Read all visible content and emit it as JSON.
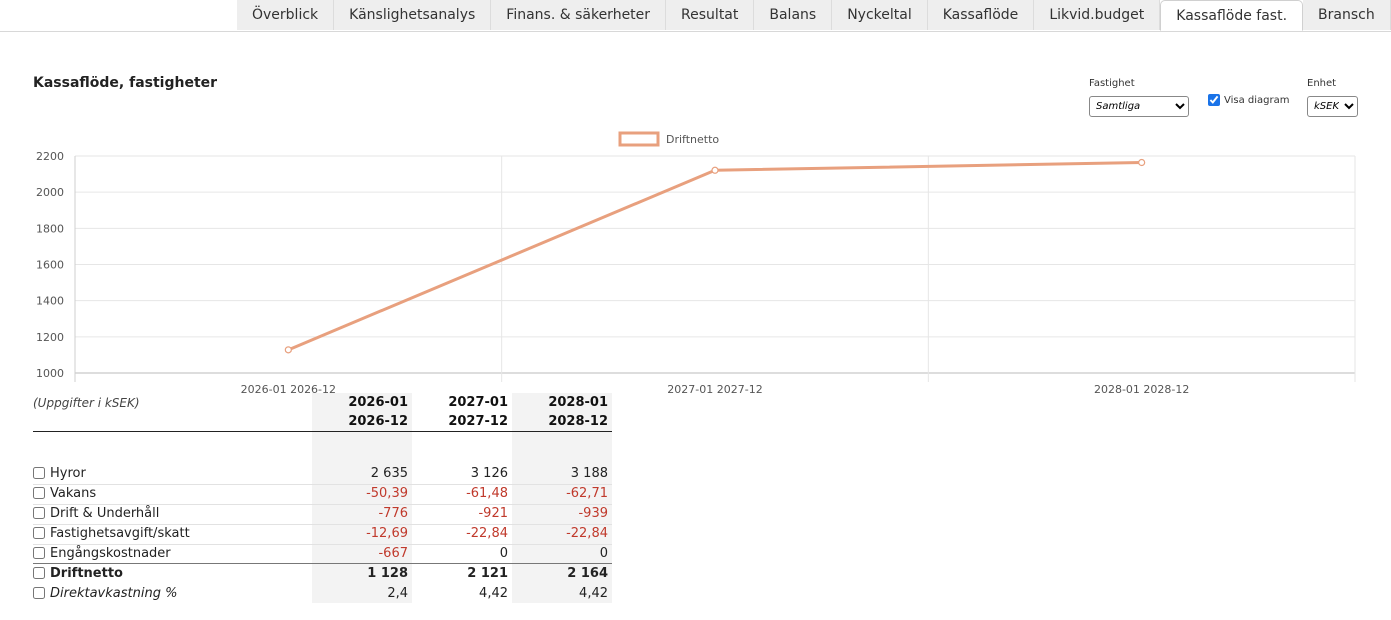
{
  "tabs": [
    {
      "label": "Överblick",
      "active": false
    },
    {
      "label": "Känslighetsanalys",
      "active": false
    },
    {
      "label": "Finans. & säkerheter",
      "active": false
    },
    {
      "label": "Resultat",
      "active": false
    },
    {
      "label": "Balans",
      "active": false
    },
    {
      "label": "Nyckeltal",
      "active": false
    },
    {
      "label": "Kassaflöde",
      "active": false
    },
    {
      "label": "Likvid.budget",
      "active": false
    },
    {
      "label": "Kassaflöde fast.",
      "active": true
    },
    {
      "label": "Bransch",
      "active": false
    }
  ],
  "page_title": "Kassaflöde, fastigheter",
  "controls": {
    "property_label": "Fastighet",
    "property_value": "Samtliga",
    "show_chart_label": "Visa diagram",
    "show_chart_checked": true,
    "unit_label": "Enhet",
    "unit_value": "kSEK"
  },
  "chart_data": {
    "type": "line",
    "categories": [
      "2026-01 2026-12",
      "2027-01 2027-12",
      "2028-01 2028-12"
    ],
    "series": [
      {
        "name": "Driftnetto",
        "values": [
          1128,
          2121,
          2164
        ],
        "color": "#e8a07e"
      }
    ],
    "yticks": [
      1000,
      1200,
      1400,
      1600,
      1800,
      2000,
      2200
    ],
    "ylim": [
      1000,
      2200
    ],
    "legend": "top-center",
    "grid": true
  },
  "table": {
    "units_note": "(Uppgifter i kSEK)",
    "columns": [
      {
        "from": "2026-01",
        "to": "2026-12"
      },
      {
        "from": "2027-01",
        "to": "2027-12"
      },
      {
        "from": "2028-01",
        "to": "2028-12"
      }
    ],
    "rows": [
      {
        "label": "Hyror",
        "values": [
          "2 635",
          "3 126",
          "3 188"
        ],
        "negative": [
          false,
          false,
          false
        ]
      },
      {
        "label": "Vakans",
        "values": [
          "-50,39",
          "-61,48",
          "-62,71"
        ],
        "negative": [
          true,
          true,
          true
        ]
      },
      {
        "label": "Drift & Underhåll",
        "values": [
          "-776",
          "-921",
          "-939"
        ],
        "negative": [
          true,
          true,
          true
        ]
      },
      {
        "label": "Fastighetsavgift/skatt",
        "values": [
          "-12,69",
          "-22,84",
          "-22,84"
        ],
        "negative": [
          true,
          true,
          true
        ]
      },
      {
        "label": "Engångskostnader",
        "values": [
          "-667",
          "0",
          "0"
        ],
        "negative": [
          true,
          false,
          false
        ]
      },
      {
        "label": "Driftnetto",
        "values": [
          "1 128",
          "2 121",
          "2 164"
        ],
        "negative": [
          false,
          false,
          false
        ],
        "bold": true
      },
      {
        "label": "Direktavkastning %",
        "values": [
          "2,4",
          "4,42",
          "4,42"
        ],
        "negative": [
          false,
          false,
          false
        ],
        "italic": true
      }
    ]
  },
  "colors": {
    "negative": "#c0392b",
    "line": "#e8a07e",
    "shade": "#f3f3f3"
  }
}
